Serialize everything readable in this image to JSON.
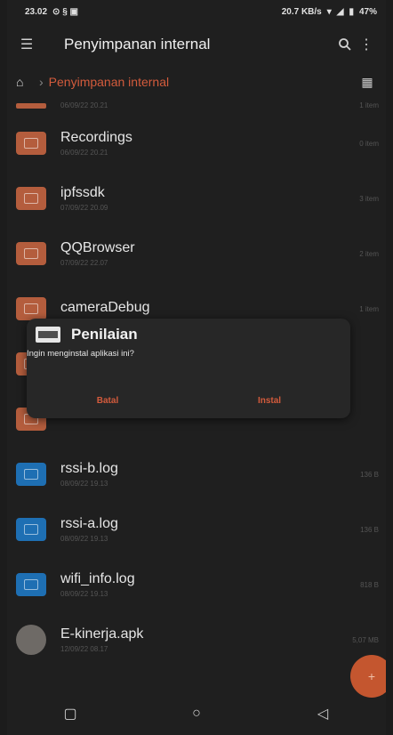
{
  "status": {
    "time": "23.02",
    "left_icons": "⊙ § ▣",
    "net_speed": "20.7 KB/s",
    "battery": "47%"
  },
  "appbar": {
    "title": "Penyimpanan internal",
    "menu_icon": "menu-icon",
    "search_icon": "search-icon",
    "more_icon": "more-vert-icon"
  },
  "breadcrumb": {
    "current": "Penyimpanan internal"
  },
  "partial_row": {
    "date": "06/09/22 20.21",
    "meta": "1 item"
  },
  "files": [
    {
      "name": "Recordings",
      "date": "06/09/22 20.21",
      "meta": "0 item",
      "kind": "folder"
    },
    {
      "name": "ipfssdk",
      "date": "07/09/22 20.09",
      "meta": "3 item",
      "kind": "folder"
    },
    {
      "name": "QQBrowser",
      "date": "07/09/22 22.07",
      "meta": "2 item",
      "kind": "folder"
    },
    {
      "name": "cameraDebug",
      "date": "",
      "meta": "1 item",
      "kind": "folder"
    },
    {
      "name": "",
      "date": "",
      "meta": "",
      "kind": "folder"
    },
    {
      "name": "",
      "date": "",
      "meta": "",
      "kind": "folder"
    },
    {
      "name": "rssi-b.log",
      "date": "08/09/22 19.13",
      "meta": "136 B",
      "kind": "file"
    },
    {
      "name": "rssi-a.log",
      "date": "08/09/22 19.13",
      "meta": "136 B",
      "kind": "file"
    },
    {
      "name": "wifi_info.log",
      "date": "08/09/22 19.13",
      "meta": "818 B",
      "kind": "file"
    },
    {
      "name": "E-kinerja.apk",
      "date": "12/09/22 08.17",
      "meta": "5,07 MB",
      "kind": "apk"
    }
  ],
  "dialog": {
    "title": "Penilaian",
    "message": "Ingin menginstal aplikasi ini?",
    "cancel": "Batal",
    "install": "Instal"
  },
  "fab": {
    "label": "+"
  },
  "colors": {
    "accent": "#d35b3c",
    "folder": "#b45d3d",
    "file": "#1e6fb3",
    "background": "#1f1f1f"
  }
}
